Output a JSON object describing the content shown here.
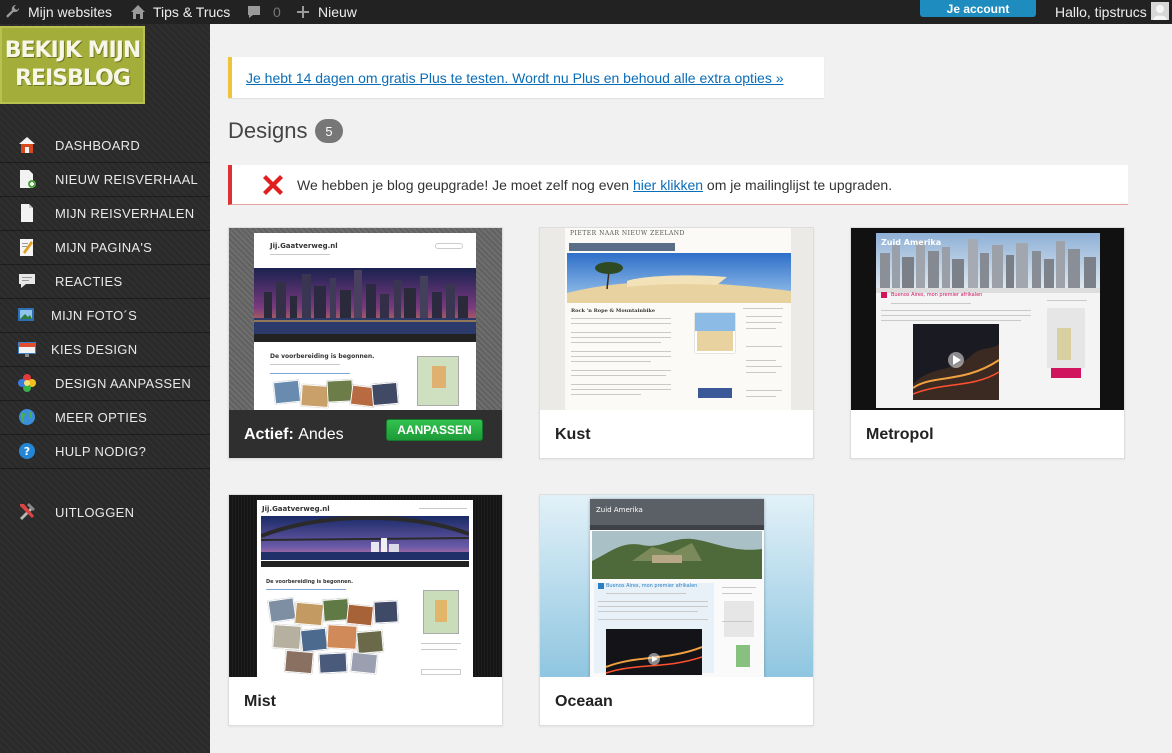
{
  "adminbar": {
    "sites_label": "Mijn websites",
    "site_label": "Tips & Trucs",
    "comments_count": "0",
    "new_label": "Nieuw",
    "account_label": "Je account",
    "greeting": "Hallo, tipstrucs"
  },
  "logo": {
    "line1": "BEKIJK MIJN",
    "line2": "REISBLOG"
  },
  "sidebar": {
    "items": [
      {
        "label": "DASHBOARD",
        "icon": "house-icon"
      },
      {
        "label": "NIEUW REISVERHAAL",
        "icon": "new-post-icon"
      },
      {
        "label": "MIJN REISVERHALEN",
        "icon": "posts-icon"
      },
      {
        "label": "MIJN PAGINA'S",
        "icon": "pages-icon"
      },
      {
        "label": "REACTIES",
        "icon": "comments-icon"
      },
      {
        "label": "MIJN FOTO´S",
        "icon": "photos-icon"
      },
      {
        "label": "KIES DESIGN",
        "icon": "design-icon"
      },
      {
        "label": "DESIGN AANPASSEN",
        "icon": "customize-icon"
      },
      {
        "label": "MEER OPTIES",
        "icon": "globe-icon"
      },
      {
        "label": "HULP NODIG?",
        "icon": "help-icon"
      },
      {
        "label": "UITLOGGEN",
        "icon": "tools-icon"
      }
    ]
  },
  "notice_plus": {
    "text": "Je hebt 14 dagen om gratis Plus te testen. Wordt nu Plus en behoud alle extra opties »"
  },
  "page": {
    "title": "Designs",
    "count": "5"
  },
  "notice_error": {
    "before": "We hebben je blog geupgrade! Je moet zelf nog even ",
    "link": "hier klikken",
    "after": " om je mailinglijst te upgraden."
  },
  "themes": [
    {
      "name": "Andes",
      "active": true,
      "active_prefix": "Actief:",
      "button": "AANPASSEN"
    },
    {
      "name": "Kust",
      "active": false
    },
    {
      "name": "Metropol",
      "active": false
    },
    {
      "name": "Mist",
      "active": false
    },
    {
      "name": "Oceaan",
      "active": false
    }
  ],
  "previews": {
    "andes": {
      "site_title": "Jij.Gaatverweg.nl",
      "post_title": "De voorbereiding is begonnen."
    },
    "kust": {
      "site_title": "Pieter naar Nieuw Zeeland",
      "post_title": "Rock 'n Rope & Mountainbike"
    },
    "metropol": {
      "site_title": "Zuid Amerika",
      "post_title": "Buenos Aires, mon premier afrikalen"
    },
    "mist": {
      "site_title": "Jij.Gaatverweg.nl",
      "post_title": "De voorbereiding is begonnen."
    },
    "oceaan": {
      "site_title": "Zuid Amerika",
      "post_title": "Buenos Aires, mon premier afrikalen"
    }
  },
  "colors": {
    "accent": "#1e8cbe",
    "warning": "#f0c33c",
    "error": "#dc3232",
    "active_button": "#1c9a37"
  }
}
